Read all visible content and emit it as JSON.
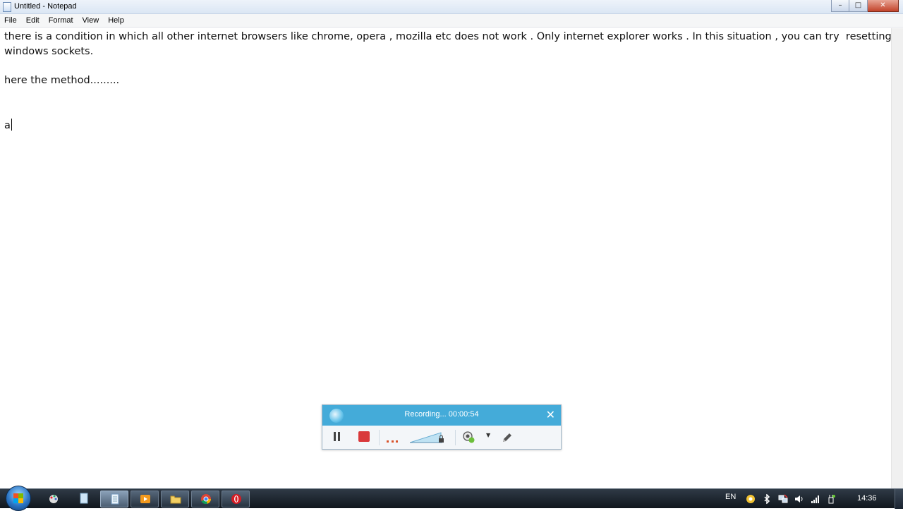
{
  "window": {
    "title": "Untitled - Notepad",
    "controls": [
      "minimize",
      "maximize",
      "close"
    ]
  },
  "menu": {
    "items": [
      "File",
      "Edit",
      "Format",
      "View",
      "Help"
    ]
  },
  "document": {
    "lines": [
      "there is a condition in which all other internet browsers like chrome, opera , mozilla etc does not work . Only internet explorer works . In this situation , you can try  resetting",
      "windows sockets.",
      "",
      "here the method.........",
      "",
      "",
      "a"
    ]
  },
  "recorder": {
    "status": "Recording... 00:00:54",
    "icons": [
      "recorder-logo-icon",
      "close-icon",
      "pause-icon",
      "stop-icon",
      "mic-level-icon",
      "volume-icon",
      "webcam-icon",
      "dropdown-icon",
      "pen-icon"
    ],
    "colors": {
      "header": "#44abd9",
      "stop": "#d9393b"
    }
  },
  "taskbar": {
    "pinned": [
      "start-orb-icon",
      "paint-icon",
      "notepad-shortcut-icon",
      "notepad-icon",
      "media-player-icon",
      "explorer-folder-icon",
      "chrome-icon",
      "opera-icon"
    ],
    "language": "EN",
    "tray_icons": [
      "camtasia-icon",
      "bluetooth-icon",
      "network-icon",
      "volume-icon",
      "signal-icon",
      "safely-remove-icon"
    ],
    "clock": "14:36"
  }
}
